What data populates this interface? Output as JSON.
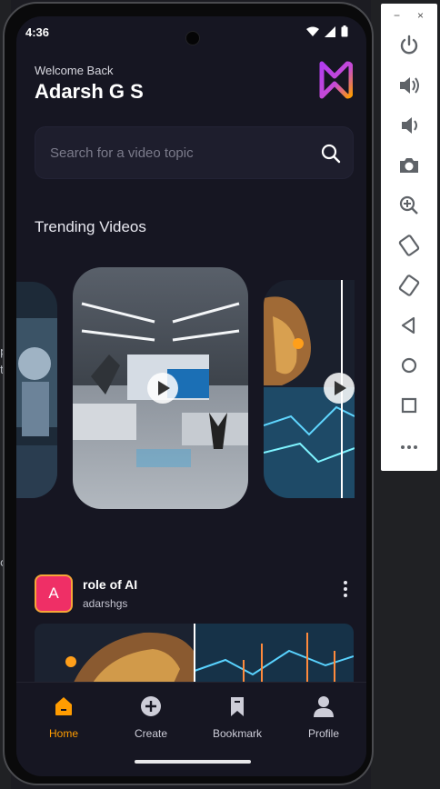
{
  "status_bar": {
    "time": "4:36"
  },
  "header": {
    "welcome": "Welcome Back",
    "username": "Adarsh G S"
  },
  "search": {
    "placeholder": "Search for a video topic"
  },
  "trending": {
    "title": "Trending Videos"
  },
  "post": {
    "avatar_letter": "A",
    "title": "role of AI",
    "author": "adarshgs"
  },
  "nav": {
    "items": [
      {
        "label": "Home",
        "icon": "home-icon",
        "active": true
      },
      {
        "label": "Create",
        "icon": "create-icon",
        "active": false
      },
      {
        "label": "Bookmark",
        "icon": "bookmark-icon",
        "active": false
      },
      {
        "label": "Profile",
        "icon": "profile-icon",
        "active": false
      }
    ]
  },
  "emulator_toolbar": {
    "window_buttons": [
      "−",
      "×"
    ],
    "tools": [
      "power-icon",
      "volume-up-icon",
      "volume-down-icon",
      "camera-icon",
      "zoom-icon",
      "rotate-left-icon",
      "rotate-right-icon",
      "back-icon",
      "home-circle-icon",
      "overview-icon",
      "more-icon"
    ]
  },
  "desktop": {
    "edge_chars": [
      "p",
      "t",
      "c"
    ]
  },
  "colors": {
    "accent": "#ff9c01",
    "background": "#161622",
    "avatar": "#ef2f66"
  }
}
